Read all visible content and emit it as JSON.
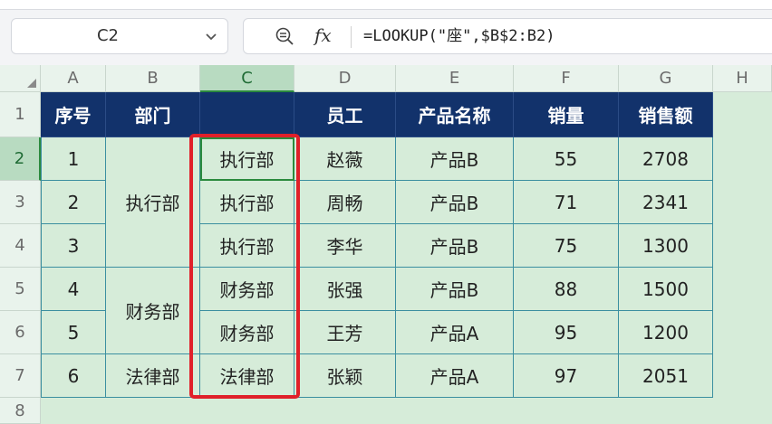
{
  "toolbar": {
    "name_box": "C2",
    "formula": "=LOOKUP(\"座\",$B$2:B2)",
    "fx_label": "fx"
  },
  "columns": [
    "A",
    "B",
    "C",
    "D",
    "E",
    "F",
    "G",
    "H"
  ],
  "rows": [
    "1",
    "2",
    "3",
    "4",
    "5",
    "6",
    "7",
    "8"
  ],
  "header": [
    "序号",
    "部门",
    "",
    "员工",
    "产品名称",
    "销量",
    "销售额"
  ],
  "merged_departments": [
    {
      "label": "执行部",
      "rows": "2-4"
    },
    {
      "label": "财务部",
      "rows": "5-6"
    },
    {
      "label": "法律部",
      "rows": "7"
    }
  ],
  "data_rows": [
    {
      "no": "1",
      "c": "执行部",
      "employee": "赵薇",
      "product": "产品B",
      "qty": "55",
      "sales": "2708"
    },
    {
      "no": "2",
      "c": "执行部",
      "employee": "周畅",
      "product": "产品B",
      "qty": "71",
      "sales": "2341"
    },
    {
      "no": "3",
      "c": "执行部",
      "employee": "李华",
      "product": "产品B",
      "qty": "75",
      "sales": "1300"
    },
    {
      "no": "4",
      "c": "财务部",
      "employee": "张强",
      "product": "产品B",
      "qty": "88",
      "sales": "1500"
    },
    {
      "no": "5",
      "c": "财务部",
      "employee": "王芳",
      "product": "产品A",
      "qty": "95",
      "sales": "1200"
    },
    {
      "no": "6",
      "c": "法律部",
      "employee": "张颖",
      "product": "产品A",
      "qty": "97",
      "sales": "2051"
    }
  ],
  "colors": {
    "header_bg": "#12326b",
    "cell_bg": "#d6ecd9",
    "highlight_border": "#e0202a",
    "active_cell_border": "#2b8a3e"
  }
}
